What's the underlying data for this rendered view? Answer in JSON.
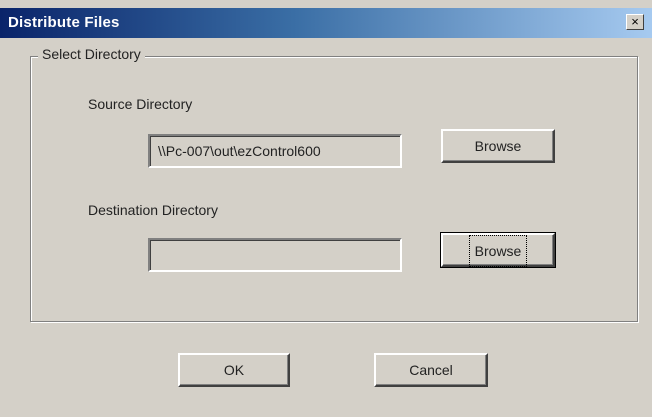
{
  "window": {
    "title": "Distribute Files",
    "close_glyph": "×"
  },
  "group": {
    "label": "Select Directory"
  },
  "source": {
    "label": "Source Directory",
    "value": "\\\\Pc-007\\out\\ezControl600",
    "browse_label": "Browse"
  },
  "destination": {
    "label": "Destination Directory",
    "value": "",
    "browse_label": "Browse"
  },
  "footer": {
    "ok_label": "OK",
    "cancel_label": "Cancel"
  }
}
